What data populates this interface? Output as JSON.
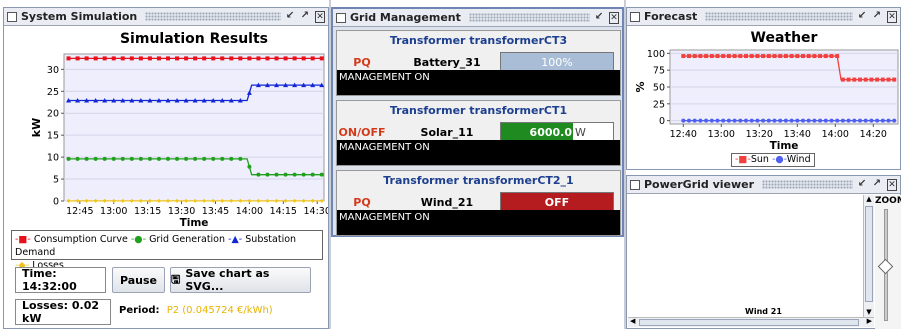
{
  "sim": {
    "window_title": "System Simulation",
    "chart_title": "Simulation Results",
    "time_label": "Time: 14:32:00",
    "pause_label": "Pause",
    "save_label": "Save chart as SVG...",
    "losses_label": "Losses: 0.02 kW",
    "period_prefix": "Period:",
    "period_value": "P2 (0.045724 €/kWh)"
  },
  "grid": {
    "window_title": "Grid Management",
    "transformers": [
      {
        "title": "Transformer transformerCT3",
        "mode": "PQ",
        "name": "Battery_31",
        "control_text": "100%",
        "status": "MANAGEMENT ON"
      },
      {
        "title": "Transformer transformerCT1",
        "mode": "ON/OFF",
        "name": "Solar_11",
        "control_text": "6000.0",
        "control_unit": "W",
        "status": "MANAGEMENT ON"
      },
      {
        "title": "Transformer transformerCT2_1",
        "mode": "PQ",
        "name": "Wind_21",
        "control_text": "OFF",
        "status": "MANAGEMENT ON"
      }
    ]
  },
  "forecast": {
    "window_title": "Forecast"
  },
  "powergrid": {
    "window_title": "PowerGrid viewer",
    "zoom_label": "ZOOM",
    "node_label": "Wind 21"
  },
  "colors": {
    "consumption": "#e8101a",
    "generation": "#21a01e",
    "demand": "#1226d6",
    "losses": "#f0c419",
    "sun": "#f04040",
    "wind": "#5060ee",
    "period": "#e8b400"
  },
  "chart_data": [
    {
      "type": "line",
      "title": "Simulation Results",
      "xlabel": "Time",
      "ylabel": "kW",
      "x_ticks": [
        "12:45",
        "13:00",
        "13:15",
        "13:30",
        "13:45",
        "14:00",
        "14:15",
        "14:30"
      ],
      "y_ticks": [
        0,
        5,
        10,
        15,
        20,
        25,
        30
      ],
      "ylim": [
        0,
        33.5
      ],
      "x_range": [
        "12:38",
        "14:33"
      ],
      "legend_position": "bottom",
      "series": [
        {
          "name": "Consumption Curve",
          "color": "#e8101a",
          "marker": "square",
          "points": [
            [
              "12:40",
              32.5
            ],
            [
              "14:32",
              32.5
            ]
          ]
        },
        {
          "name": "Grid Generation",
          "color": "#21a01e",
          "marker": "circle",
          "points": [
            [
              "12:40",
              9.6
            ],
            [
              "13:59",
              9.6
            ],
            [
              "14:01",
              6.0
            ],
            [
              "14:32",
              6.0
            ]
          ]
        },
        {
          "name": "Substation Demand",
          "color": "#1226d6",
          "marker": "triangle",
          "points": [
            [
              "12:40",
              22.9
            ],
            [
              "13:59",
              22.9
            ],
            [
              "14:01",
              26.4
            ],
            [
              "14:32",
              26.4
            ]
          ]
        },
        {
          "name": "Losses",
          "color": "#f0c419",
          "marker": "diamond",
          "points": [
            [
              "12:40",
              0.02
            ],
            [
              "14:32",
              0.02
            ]
          ]
        }
      ]
    },
    {
      "type": "line",
      "title": "Weather",
      "xlabel": "Time",
      "ylabel": "%",
      "x_ticks": [
        "12:40",
        "13:00",
        "13:20",
        "13:40",
        "14:00",
        "14:20"
      ],
      "y_ticks": [
        0,
        25,
        50,
        75,
        100
      ],
      "ylim": [
        -5,
        105
      ],
      "x_range": [
        "12:33",
        "14:33"
      ],
      "legend_position": "bottom",
      "series": [
        {
          "name": "Sun",
          "color": "#f04040",
          "marker": "square",
          "points": [
            [
              "12:40",
              96
            ],
            [
              "14:01",
              96
            ],
            [
              "14:03",
              61
            ],
            [
              "14:32",
              61
            ]
          ]
        },
        {
          "name": "Wind",
          "color": "#5060ee",
          "marker": "circle",
          "points": [
            [
              "12:40",
              0
            ],
            [
              "14:32",
              0
            ]
          ]
        }
      ]
    }
  ]
}
